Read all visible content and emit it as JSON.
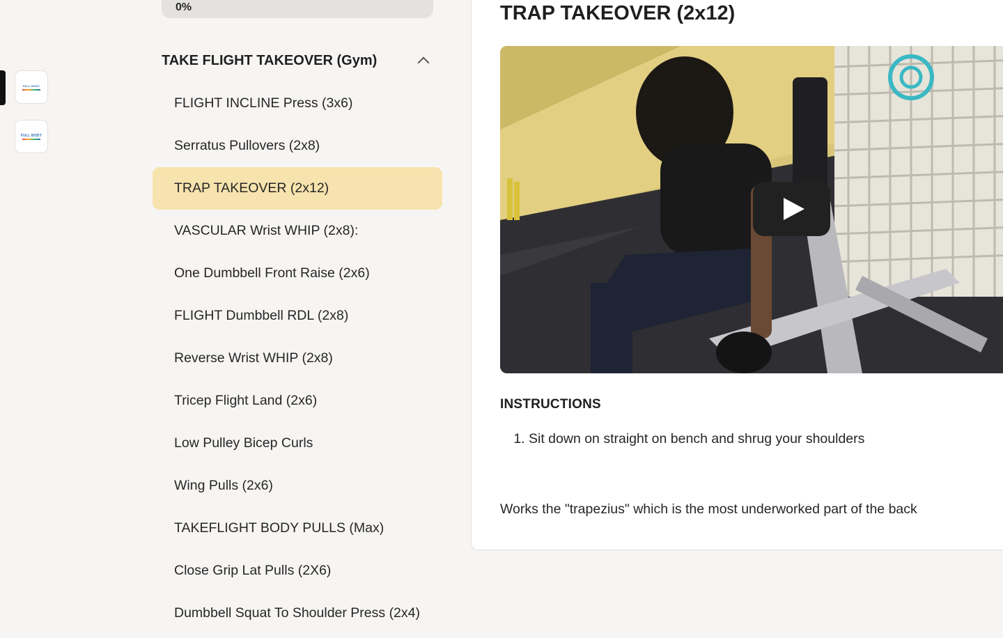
{
  "progress": {
    "label": "0%",
    "value": 0
  },
  "rail": {
    "apps": [
      {
        "logo_text": "FULL BODY"
      },
      {
        "logo_text": "FULL BODY"
      }
    ]
  },
  "section": {
    "title": "TAKE FLIGHT TAKEOVER (Gym)"
  },
  "lessons": [
    "FLIGHT INCLINE Press (3x6)",
    "Serratus Pullovers (2x8)",
    "TRAP TAKEOVER (2x12)",
    "VASCULAR Wrist WHIP (2x8):",
    "One Dumbbell Front Raise (2x6)",
    "FLIGHT Dumbbell RDL (2x8)",
    "Reverse Wrist WHIP (2x8)",
    "Tricep Flight Land (2x6)",
    "Low Pulley Bicep Curls",
    "Wing Pulls (2x6)",
    "TAKEFLIGHT BODY PULLS (Max)",
    "Close Grip Lat Pulls (2X6)",
    "Dumbbell Squat To Shoulder Press (2x4)"
  ],
  "active_lesson_index": 2,
  "content": {
    "title": "TRAP TAKEOVER (2x12)",
    "instructions_heading": "INSTRUCTIONS",
    "instructions": [
      "Sit down on straight on bench and shrug your shoulders"
    ],
    "description": "Works the \"trapezius\" which is the most underworked part of the back"
  },
  "colors": {
    "active_highlight": "#f6e3ad",
    "background": "#f7f5f3"
  }
}
